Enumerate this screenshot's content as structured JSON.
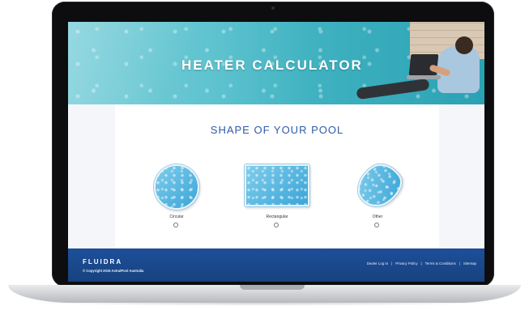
{
  "hero": {
    "title": "HEATER CALCULATOR"
  },
  "main": {
    "heading": "SHAPE OF YOUR POOL",
    "options": [
      {
        "label": "Circular",
        "selected": false
      },
      {
        "label": "Rectangular",
        "selected": false
      },
      {
        "label": "Other",
        "selected": false
      }
    ]
  },
  "footer": {
    "brand": "FLUIDRA",
    "copyright": "© Copyright 2019 AstralPool Australia",
    "links": [
      {
        "label": "Dealer Log In"
      },
      {
        "label": "Privacy Policy"
      },
      {
        "label": "Terms & Conditions"
      },
      {
        "label": "Sitemap"
      }
    ],
    "separator": "|"
  },
  "colors": {
    "brand_blue": "#1d4f9a",
    "heading_blue": "#2c5ba8",
    "pool_blue": "#3aa5d8"
  },
  "icons": {
    "circular": "circular-pool-icon",
    "rectangular": "rectangular-pool-icon",
    "other": "kidney-pool-icon"
  }
}
